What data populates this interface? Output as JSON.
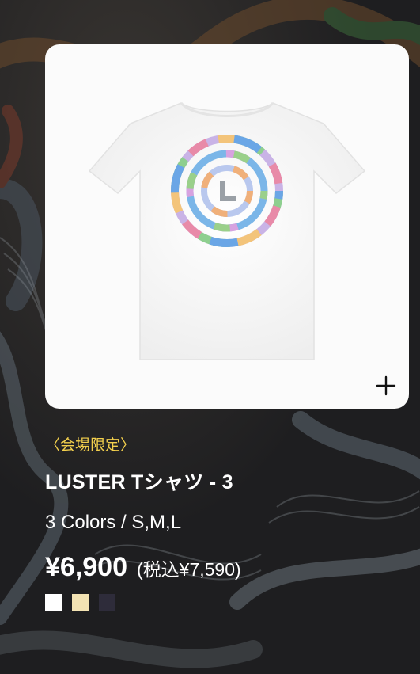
{
  "product": {
    "tag_open": "〈",
    "tag_text": "会場限定",
    "tag_close": "〉",
    "title": "LUSTER Tシャツ - 3",
    "variants": "3 Colors / S,M,L",
    "price": "¥6,900",
    "tax_price": "(税込¥7,590)",
    "swatches": [
      {
        "color": "#ffffff"
      },
      {
        "color": "#f3e3b3"
      },
      {
        "color": "#2e2c3a"
      }
    ]
  },
  "colors": {
    "tag": "#f2cf4d",
    "card_bg": "#fbfbfb",
    "text": "#ffffff"
  },
  "icons": {
    "zoom": "plus-icon"
  }
}
